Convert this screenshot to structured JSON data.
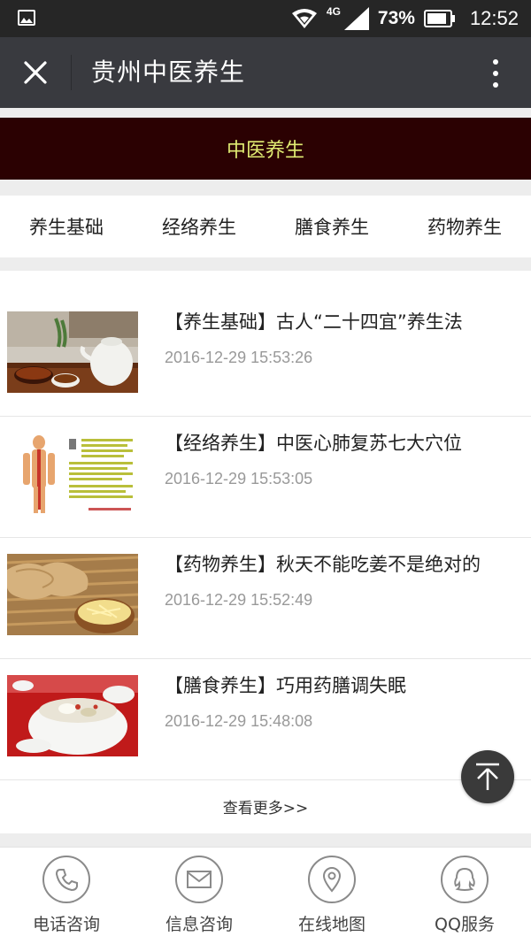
{
  "status_bar": {
    "network": "4G",
    "battery": "73%",
    "time": "12:52"
  },
  "title_bar": {
    "title": "贵州中医养生"
  },
  "banner": {
    "title": "中医养生"
  },
  "categories": [
    {
      "label": "养生基础"
    },
    {
      "label": "经络养生"
    },
    {
      "label": "膳食养生"
    },
    {
      "label": "药物养生"
    }
  ],
  "articles": [
    {
      "title": "【养生基础】古人“二十四宜”养生法",
      "date": "2016-12-29 15:53:26",
      "thumb": "tea-set-image"
    },
    {
      "title": "【经络养生】中医心肺复苏七大穴位",
      "date": "2016-12-29 15:53:05",
      "thumb": "acupoint-chart-image"
    },
    {
      "title": "【药物养生】秋天不能吃姜不是绝对的",
      "date": "2016-12-29 15:52:49",
      "thumb": "ginger-image"
    },
    {
      "title": "【膳食养生】巧用药膳调失眠",
      "date": "2016-12-29 15:48:08",
      "thumb": "soup-pot-image"
    }
  ],
  "more_label": "查看更多>>",
  "bottom_nav": [
    {
      "label": "电话咨询",
      "icon": "phone-icon"
    },
    {
      "label": "信息咨询",
      "icon": "mail-icon"
    },
    {
      "label": "在线地图",
      "icon": "map-pin-icon"
    },
    {
      "label": "QQ服务",
      "icon": "qq-icon"
    }
  ],
  "colors": {
    "title_bar": "#393a3f",
    "banner_bg": "#2b0102",
    "banner_text": "#e0ec72"
  }
}
